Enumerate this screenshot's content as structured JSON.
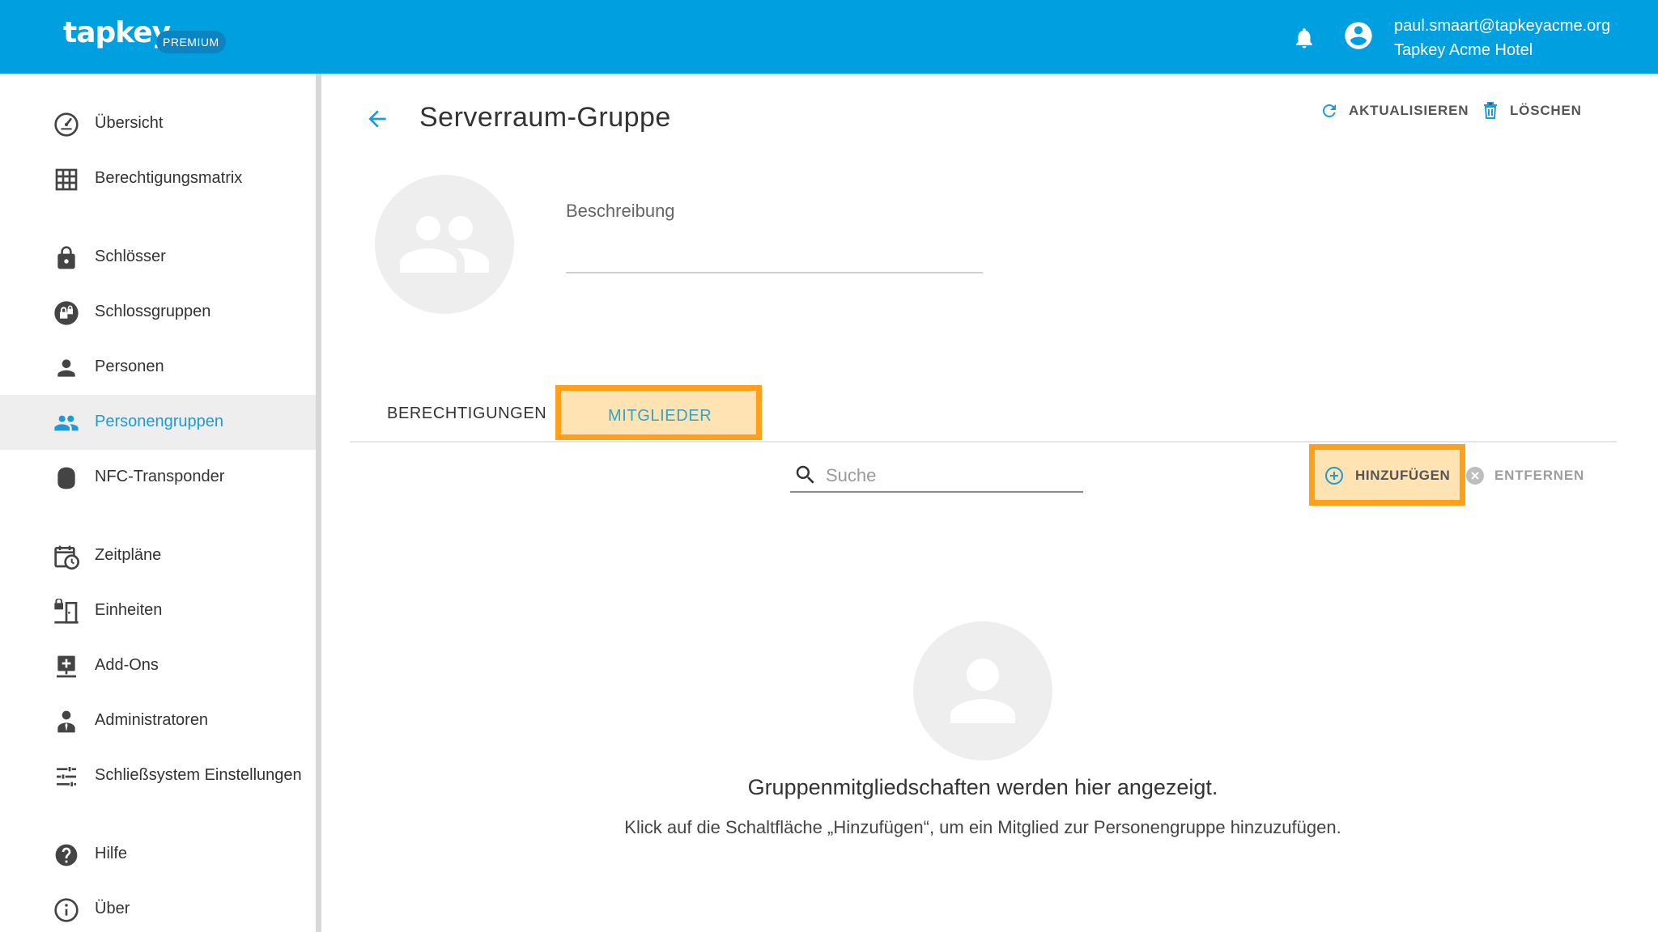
{
  "header": {
    "logo_text": "tapkey",
    "premium_badge": "PREMIUM",
    "user_email": "paul.smaart@tapkeyacme.org",
    "user_org": "Tapkey Acme Hotel",
    "bell_icon": "bell-icon",
    "account_icon": "account-circle-icon",
    "brand_color": "#009fdf"
  },
  "sidebar": {
    "items": [
      {
        "label": "Übersicht",
        "icon": "dashboard-icon"
      },
      {
        "label": "Berechtigungsmatrix",
        "icon": "grid-icon"
      },
      {
        "label": "Schlösser",
        "icon": "lock-icon"
      },
      {
        "label": "Schlossgruppen",
        "icon": "lock-group-icon"
      },
      {
        "label": "Personen",
        "icon": "person-icon"
      },
      {
        "label": "Personengruppen",
        "icon": "people-icon",
        "active": true
      },
      {
        "label": "NFC-Transponder",
        "icon": "nfc-tag-icon"
      },
      {
        "label": "Zeitpläne",
        "icon": "calendar-clock-icon"
      },
      {
        "label": "Einheiten",
        "icon": "unit-door-icon"
      },
      {
        "label": "Add-Ons",
        "icon": "addon-icon"
      },
      {
        "label": "Administratoren",
        "icon": "admin-icon"
      },
      {
        "label": "Schließsystem Einstellungen",
        "icon": "sliders-icon"
      },
      {
        "label": "Hilfe",
        "icon": "help-icon"
      },
      {
        "label": "Über",
        "icon": "info-icon"
      }
    ],
    "active_color": "#1e9bd7"
  },
  "main": {
    "title": "Serverraum-Gruppe",
    "refresh_label": "AKTUALISIEREN",
    "delete_label": "LÖSCHEN",
    "description_label": "Beschreibung",
    "description_value": "",
    "tabs": [
      {
        "label": "BERECHTIGUNGEN"
      },
      {
        "label": "MITGLIEDER",
        "active": true
      }
    ],
    "search_placeholder": "Suche",
    "add_label": "HINZUFÜGEN",
    "remove_label": "ENTFERNEN",
    "empty_title": "Gruppenmitgliedschaften werden hier angezeigt.",
    "empty_text": "Klick auf die Schaltfläche „Hinzufügen“, um ein Mitglied zur Personengruppe hinzuzufügen.",
    "highlight_color": "#ff9f1a"
  }
}
